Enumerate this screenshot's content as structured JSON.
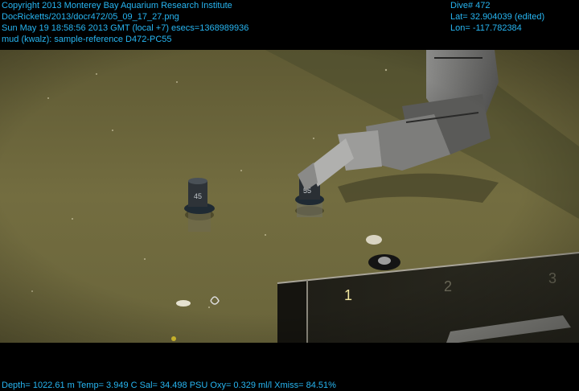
{
  "header_left": {
    "line1": "Copyright 2013 Monterey Bay Aquarium Research Institute",
    "line2": "DocRicketts/2013/docr472/05_09_17_27.png",
    "line3": "Sun May 19 18:58:56 2013 GMT (local +7)  esecs=1368989936",
    "line4": "mud (kwalz): sample-reference D472-PC55"
  },
  "header_right": {
    "dive": "Dive# 472",
    "lat": "Lat= 32.904039 (edited)",
    "lon": "Lon= -117.782384"
  },
  "footer": {
    "telemetry": "Depth= 1022.61 m  Temp= 3.949 C  Sal= 34.498 PSU  Oxy= 0.329 ml/l  Xmiss= 84.51%"
  },
  "scene": {
    "core_left_label": "45",
    "core_right_label": "55",
    "quiver_label_1": "1",
    "quiver_label_2": "2",
    "quiver_label_3": "3"
  },
  "colors": {
    "overlay_text": "#27b6f2",
    "seafloor": "#6f6a3e",
    "seafloor_dark": "#4b4a2c"
  }
}
